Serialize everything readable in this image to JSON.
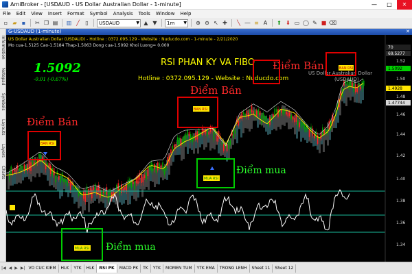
{
  "window": {
    "title": "AmiBroker - [USDAUD - US Dollar Australian Dollar - 1-minute]",
    "buttons": [
      "—",
      "□",
      "✕"
    ]
  },
  "menu": [
    "File",
    "Edit",
    "View",
    "Insert",
    "Format",
    "Symbol",
    "Analysis",
    "Tools",
    "Window",
    "Help"
  ],
  "toolbar": {
    "symbol_value": "USDAUD",
    "interval_value": "1m"
  },
  "left_tabs": [
    "Information",
    "Notepad",
    "Symbols",
    "Layouts",
    "Layers",
    "Charts"
  ],
  "chart_window_title": "G-USDAUD (1-minute)",
  "chart": {
    "info_line1": "US Dollar Australian Dollar (USDAUD) - Hotline : 0372.095.129 - Website : Nuducdo.com - 1-minute - 2/21/2020",
    "info_line2": "Mo cua-1.5125  Cao-1.5184  Thap-1.5063  Dong cua-1.5092  Khoi Luong=  0.000",
    "price_big": "1.5092",
    "price_change": "-0.01 (-0.67%)",
    "heading": "RSI PHAN KY VA FIBO",
    "hotline": "Hotline : 0372.095.129 - Website : Nuducdo.com",
    "symbol_name": "US Dollar Australian Dollar",
    "symbol_code": "(USDAUD)",
    "annotations": {
      "sell1": "Điểm Bán",
      "sell2": "Điểm Bán",
      "sell3": "Điểm Bán",
      "buy1": "Điểm mua",
      "buy2": "Điểm mua"
    },
    "marker_labels": {
      "ban_rsi": "BAN RSI",
      "mua_rsi": "MUA RSI"
    },
    "price_axis": [
      "1.52",
      "1.50",
      "1.48",
      "1.46",
      "1.44",
      "1.42",
      "1.40",
      "1.38",
      "1.36",
      "1.34"
    ],
    "price_axis_tags": [
      "70",
      "69.5277",
      "1.5092",
      "1.4928",
      "1.47744",
      "1.46"
    ]
  },
  "sheet_tabs": [
    "VO CUC KIEM",
    "HLK",
    "YTK",
    "HLK",
    "RSI PK",
    "MACD PK",
    "TK",
    "YTK",
    "MOMEN TUM",
    "YTK EMA",
    "TRONG LENH",
    "Sheet 11",
    "Sheet 12"
  ],
  "active_sheet_index": 4,
  "colors": {
    "background": "#000000",
    "sell_box": "#e00000",
    "buy_box": "#00cc00",
    "sell_text": "#ff2a2a",
    "buy_text": "#2cff2c",
    "heading": "#ffff00",
    "price_big": "#00ff00",
    "up_candle": "#00a000",
    "down_candle": "#ff2020",
    "cloud": "#8a8a8a",
    "rsi_line": "#ffffff",
    "rsi_level": "#1abc9c"
  }
}
